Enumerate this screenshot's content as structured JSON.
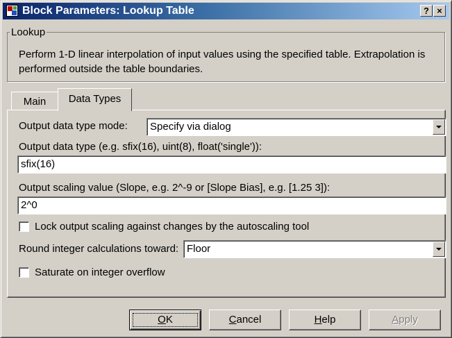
{
  "window": {
    "title": "Block Parameters: Lookup Table",
    "help_caption": "?",
    "close_caption": "×"
  },
  "group": {
    "legend": "Lookup",
    "description": "Perform 1-D linear interpolation of input values using the specified table.  Extrapolation is performed outside the table boundaries."
  },
  "tabs": [
    {
      "label": "Main",
      "selected": false
    },
    {
      "label": "Data Types",
      "selected": true
    }
  ],
  "form": {
    "output_mode_label": "Output data type mode:",
    "output_mode_value": "Specify via dialog",
    "output_type_label": "Output data type (e.g. sfix(16), uint(8), float('single')):",
    "output_type_value": "sfix(16)",
    "scaling_label": "Output scaling value (Slope, e.g. 2^-9 or [Slope Bias], e.g. [1.25 3]):",
    "scaling_value": "2^0",
    "lock_label": "Lock output scaling against changes by the autoscaling tool",
    "lock_checked": false,
    "round_label": "Round integer calculations toward:",
    "round_value": "Floor",
    "saturate_label": "Saturate on integer overflow",
    "saturate_checked": false
  },
  "buttons": {
    "ok_mn": "O",
    "ok_rest": "K",
    "cancel_mn": "C",
    "cancel_rest": "ancel",
    "help_mn": "H",
    "help_rest": "elp",
    "apply_mn": "A",
    "apply_rest": "pply"
  },
  "icons": {
    "window_icon": "simulink-block-icon",
    "dropdown": "chevron-down-icon"
  }
}
